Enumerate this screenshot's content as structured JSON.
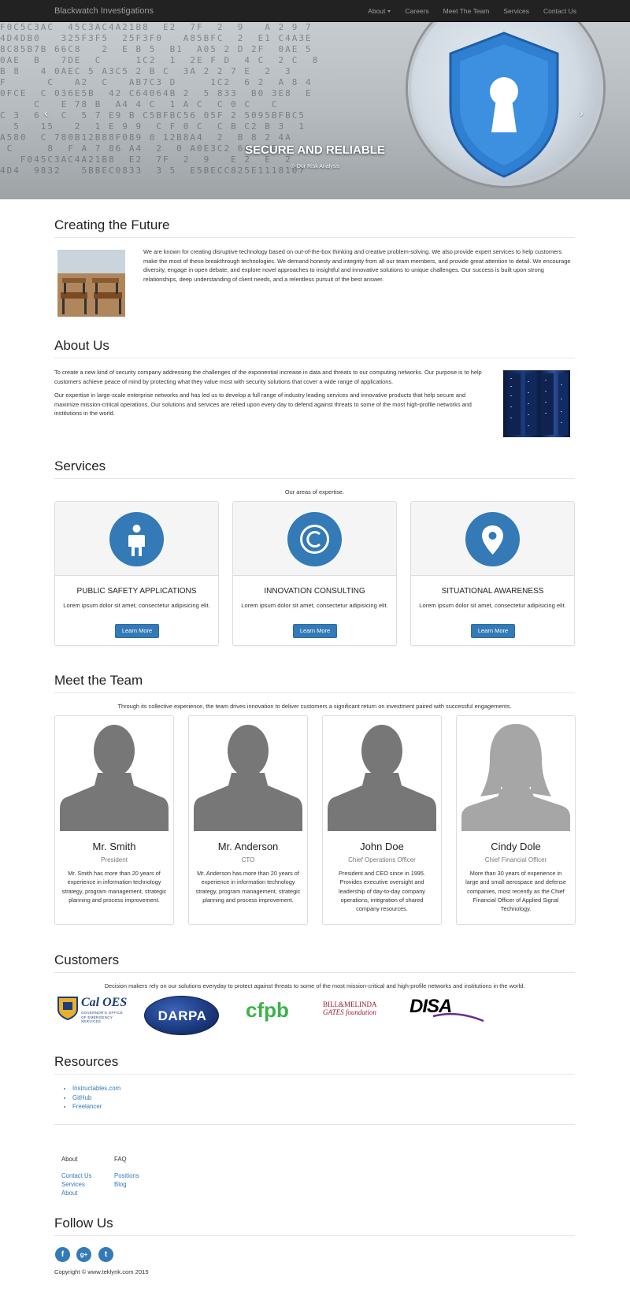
{
  "navbar": {
    "brand": "Blackwatch Investigations",
    "items": [
      "About",
      "Careers",
      "Meet The Team",
      "Services",
      "Contact Us"
    ]
  },
  "hero": {
    "caption": "SECURE AND RELIABLE",
    "subcaption": "Our Risk Analysis",
    "prev": "‹",
    "next": "›"
  },
  "future": {
    "title": "Creating the Future",
    "text": "We are known for creating disruptive technology based on out-of-the-box thinking and creative problem-solving. We also provide expert services to help customers make the most of these breakthrough technologies. We demand honesty and integrity from all our team members, and provide great attention to detail.  We encourage diversity, engage in open debate, and explore novel approaches to insightful and innovative solutions to unique challenges. Our success is built upon strong relationships, deep understanding of client needs, and a relentless pursuit of the best answer."
  },
  "about": {
    "title": "About Us",
    "p1": "To create a new kind of security company addressing the challenges of the exponential increase in data and threats to our computing networks. Our purpose is to help customers achieve peace of mind by protecting what they value most with security solutions that cover a wide range of applications.",
    "p2": "Our expertise in large-scale enterprise networks and  has led us to develop a full range of industry leading services and innovative products that help secure and maximize mission-critical operations. Our solutions and services are relied upon every day to defend against threats to some of the most high-profile networks and institutions in the world."
  },
  "services": {
    "title": "Services",
    "subtitle": "Our areas of expertise.",
    "cards": [
      {
        "title": "PUBLIC SAFETY APPLICATIONS",
        "text": "Lorem ipsum dolor sit amet, consectetur adipisicing elit.",
        "button": "Learn More",
        "icon": "person-icon"
      },
      {
        "title": "INNOVATION CONSULTING",
        "text": "Lorem ipsum dolor sit amet, consectetur adipisicing elit.",
        "button": "Learn More",
        "icon": "copyright-icon"
      },
      {
        "title": "SITUATIONAL AWARENESS",
        "text": "Lorem ipsum dolor sit amet, consectetur adipisicing elit.",
        "button": "Learn More",
        "icon": "map-marker-icon"
      }
    ]
  },
  "team": {
    "title": "Meet the Team",
    "subtitle": "Through its collective experience, the team drives innovation to deliver customers a significant return on investment paired with successful engagements.",
    "members": [
      {
        "name": "Mr. Smith",
        "role": "President",
        "bio": "Mr. Smith has more than 20 years of experience in information technology strategy, program management, strategic planning and process improvement."
      },
      {
        "name": "Mr. Anderson",
        "role": "CTO",
        "bio": "Mr. Anderson has more than 20 years of experience in information technology strategy, program management, strategic planning and process improvement."
      },
      {
        "name": "John Doe",
        "role": "Chief Operations Officer",
        "bio": "President and CEO since in 1995. Provides executive oversight and leadership of day-to-day company operations, integration of shared company resources."
      },
      {
        "name": "Cindy Dole",
        "role": "Chief Financial Officer",
        "bio": "More than 30 years of experience in large and small aerospace and defense companies, most recently as the Chief Financial Officer of Applied Signal Technology."
      }
    ]
  },
  "customers": {
    "title": "Customers",
    "subtitle": "Decision makers rely on our solutions everyday to protect against threats to some of the most mission-critical and high-profile networks and institutions in the world.",
    "logos": {
      "caloes": "Cal OES",
      "caloes_sub1": "GOVERNOR'S OFFICE",
      "caloes_sub2": "OF EMERGENCY SERVICES",
      "darpa": "DARPA",
      "cfpb": "cfpb",
      "gates1": "BILL&MELINDA",
      "gates2": "GATES foundation",
      "disa": "DISA"
    }
  },
  "resources": {
    "title": "Resources",
    "links": [
      "Instructables.com",
      "GitHub",
      "Freelancer"
    ]
  },
  "footer": {
    "col1_head": "About",
    "col1_links": [
      "Contact Us",
      "Services",
      "About"
    ],
    "col2_head": "FAQ",
    "col2_links": [
      "Positions",
      "Blog"
    ]
  },
  "follow": {
    "title": "Follow Us",
    "icons": [
      "f",
      "g+",
      "t"
    ],
    "copyright": "Copyright © www.teklynk.com 2015"
  },
  "colors": {
    "primary": "#337ab7",
    "navbar": "#222222"
  }
}
